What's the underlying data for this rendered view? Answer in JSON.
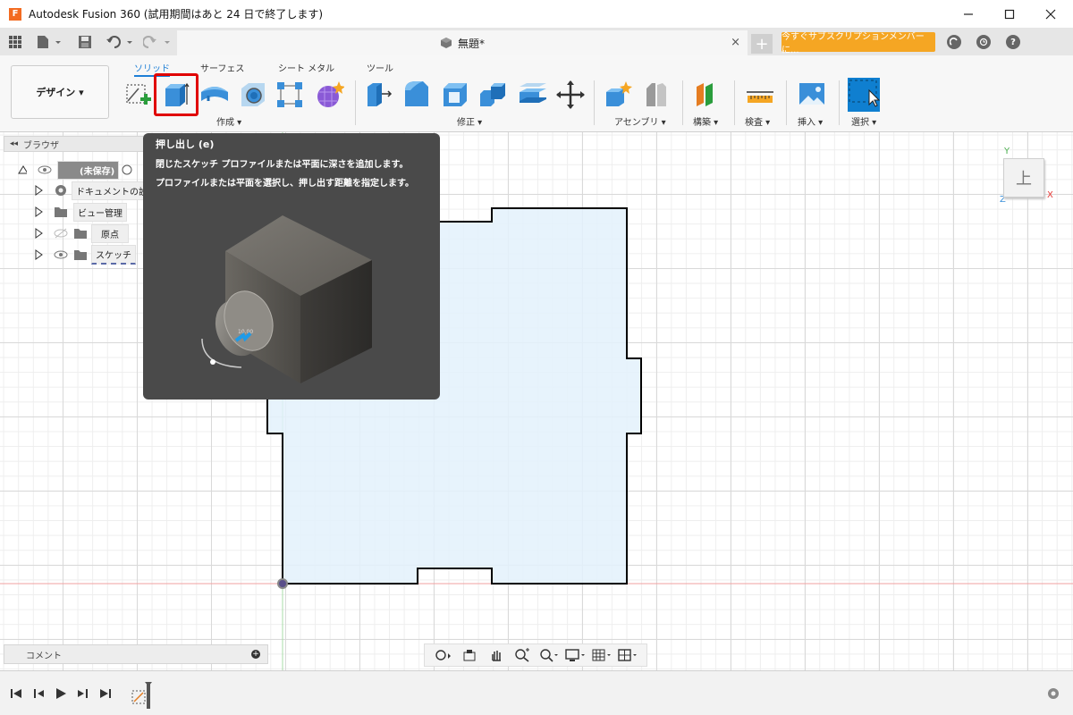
{
  "window": {
    "title": "Autodesk Fusion 360 (試用期間はあと 24 日で終了します)",
    "logo_letter": "F"
  },
  "tabbar": {
    "doc_title": "無題*",
    "close": "×",
    "new_tab": "+",
    "subscribe": "今すぐサブスクリプションメンバーに..."
  },
  "ribbon": {
    "workspace": "デザイン ▾",
    "tabs": [
      "ソリッド",
      "サーフェス",
      "シート メタル",
      "ツール"
    ],
    "groups": [
      "作成 ▾",
      "修正 ▾",
      "アセンブリ ▾",
      "構築 ▾",
      "検査 ▾",
      "挿入 ▾",
      "選択 ▾"
    ]
  },
  "browser": {
    "header": "ブラウザ",
    "items": [
      {
        "label": "(未保存)"
      },
      {
        "label": "ドキュメントの設"
      },
      {
        "label": "ビュー管理"
      },
      {
        "label": "原点"
      },
      {
        "label": "スケッチ"
      }
    ]
  },
  "tooltip": {
    "title": "押し出し (e)",
    "desc1": "閉じたスケッチ プロファイルまたは平面に深さを追加します。",
    "desc2": "プロファイルまたは平面を選択し、押し出す距離を指定します。",
    "dial_value": "10.00"
  },
  "viewcube": {
    "face": "上",
    "axis_x": "X",
    "axis_y": "Y",
    "axis_z": "Z"
  },
  "comment": {
    "label": "コメント"
  },
  "colors": {
    "accent": "#1e7fd6",
    "highlight": "#e00000",
    "subscribe": "#f5a623",
    "tooltip_bg": "#4a4a4a",
    "sketch_fill": "#e3f1fb"
  }
}
